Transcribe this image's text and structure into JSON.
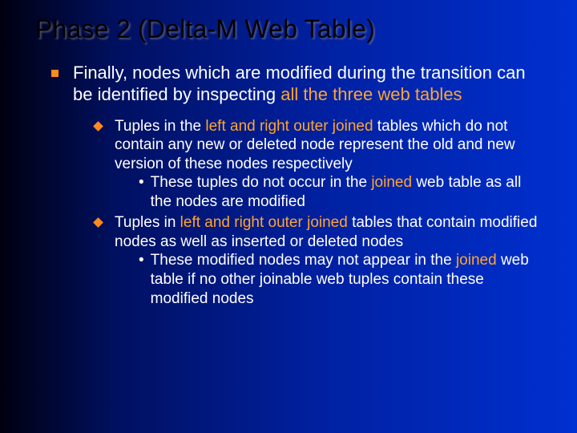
{
  "slide": {
    "title": "Phase 2 (Delta-M Web Table)",
    "lvl1": {
      "pre": "Finally, nodes which are modified during the transition can be identified by inspecting ",
      "accent": "all the three web tables"
    },
    "sub": [
      {
        "pre": "Tuples in the ",
        "accent": "left and right outer joined",
        "post": " tables which do not contain any new or deleted node represent the old and new version of these nodes respectively",
        "lvl3": {
          "pre": "These tuples do not occur in the ",
          "accent": "joined",
          "post": " web table as all the nodes are modified"
        }
      },
      {
        "pre": "Tuples in ",
        "accent": "left and right outer joined",
        "post": " tables that contain modified nodes as well as inserted or deleted nodes",
        "lvl3": {
          "pre": "These modified nodes may not appear in the ",
          "accent": "joined",
          "post": " web table if no other joinable web tuples contain these modified nodes"
        }
      }
    ]
  }
}
